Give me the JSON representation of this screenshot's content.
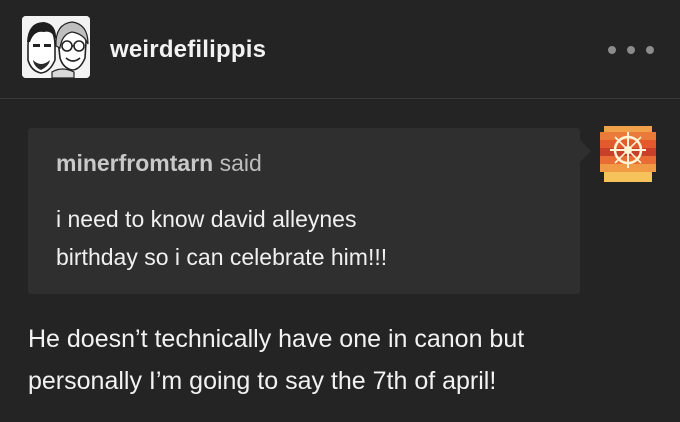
{
  "post": {
    "username": "weirdefilippis",
    "avatar_icon": "blog-avatar-illustration-icon",
    "more_icon": "more-options-icon"
  },
  "ask": {
    "asker": "minerfromtarn",
    "said_label": "said",
    "question_line1": "i need to know david alleynes",
    "question_line2": "birthday so i can celebrate him!!!",
    "asker_avatar_icon": "asker-avatar-icon",
    "card_color": "#2f2f2f"
  },
  "answer": {
    "line1": "He doesn’t technically have one in canon but",
    "line2": "personally I’m going to say the 7th of april!"
  },
  "theme": {
    "background": "#242424",
    "accent_orange": "#e8622e"
  }
}
